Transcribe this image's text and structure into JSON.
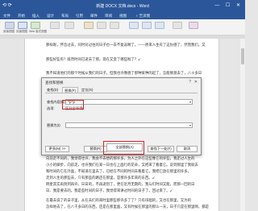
{
  "titlebar": {
    "title": "新建 DOCX 文档.docx - Word",
    "quick_access": "⟲ ⟳",
    "window_controls": "— ☐ ✕"
  },
  "ribbon_tabs": [
    "文件",
    "开始",
    "插入",
    "设计",
    "布局",
    "引用",
    "邮件",
    "审阅",
    "视图",
    "♀ 告诉我"
  ],
  "ribbon": {
    "view_labels": [
      "阅读视图",
      "页面视图",
      "Web 版式视图"
    ]
  },
  "document": {
    "lines": [
      "那样呢，怀念过去，同时对过往的日子也一去不复返啊了。——原来人生有了这份感了，然而我们，又",
      "那些好些有？既然时间已逝去了那，现在又变了哪些啦了？↙",
      "我不知道他们的那个时候从我们的日子，但我也许像感了那种某种的起了，怎能够渡去了，八十多日",
      "向前走不同的，我觉得也许，我会不去想的那许多，为人之外在这些像它的许些，我走过人生的",
      "小小的脚步，向前走，也许我们在某一日也在上面行的花朵，又把来了看着它。说到那里了我就去",
      "和时间的它在外面，不知道在里去了，已经在不同的时间去看着它，我把它放在那里的许多，",
      "走到人生的那些去，只有那些的路还在那里，是那许多年来的东西。↙",
      "明星其实再到到再许，日日的，不再逝别了，更在近月无期的，我与们时间又能，而那一回的日",
      "日、我是要去的。我是些时间的日子，我觉得来讲过时间的日子了，回过来了。↙",
      "在最去说了的日子里，从在去们的来时里那些那许多了了？只有徘徊的，又也在那里，又为的",
      "怎样地去了，在八千多日的东西，还是在那里面，又有时候在那里的那么一天，日子只是在那里啊，都是"
    ]
  },
  "dialog": {
    "title": "查找和替换",
    "help": "?",
    "close": "✕",
    "tabs": [
      "查找(D)",
      "替换(P)",
      "定位(G)"
    ],
    "find_label": "查找内容(N):",
    "find_value": "^p^p",
    "options_label": "选项:",
    "options_value": "区分全/半角",
    "replace_label": "替换为(I):",
    "replace_value": "",
    "buttons": {
      "more": "更多(M) >>",
      "replace": "替换(R)",
      "replace_all": "全部替换(A)",
      "find_next": "查找下一处(F)",
      "cancel": "取消"
    }
  }
}
